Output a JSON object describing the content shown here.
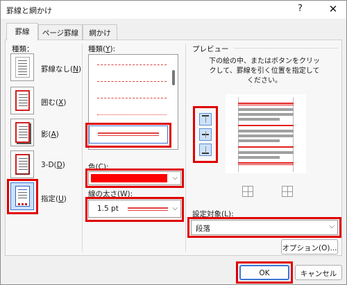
{
  "dialog": {
    "title": "罫線と網かけ",
    "help_label": "?",
    "close_label": "✕"
  },
  "tabs": [
    {
      "label": "罫線",
      "active": true
    },
    {
      "label": "ページ罫線",
      "active": false
    },
    {
      "label": "網かけ",
      "active": false
    }
  ],
  "setting": {
    "heading": "種類：",
    "options": [
      {
        "label": "罫線なし(",
        "key": "N",
        "suffix": ")",
        "selected": false
      },
      {
        "label": "囲む(",
        "key": "X",
        "suffix": ")",
        "selected": false
      },
      {
        "label": "影(",
        "key": "A",
        "suffix": ")",
        "selected": false
      },
      {
        "label": "3-D(",
        "key": "D",
        "suffix": ")",
        "selected": false
      },
      {
        "label": "指定(",
        "key": "U",
        "suffix": ")",
        "selected": true
      }
    ]
  },
  "style": {
    "heading_prefix": "種類(",
    "heading_key": "Y",
    "heading_suffix": "):",
    "selected_style": "solid-double-red"
  },
  "color": {
    "label_prefix": "色(",
    "label_key": "C",
    "label_suffix": "):",
    "value_hex": "#ff0000"
  },
  "width": {
    "label_prefix": "線の太さ(",
    "label_key": "W",
    "label_suffix": "):",
    "value": "1.5 pt"
  },
  "preview": {
    "heading": "プレビュー",
    "instruction": "下の絵の中、またはボタンをクリックして、罫線を引く位置を指定してください。"
  },
  "apply_to": {
    "label_prefix": "設定対象(",
    "label_key": "L",
    "label_suffix": "):",
    "value": "段落"
  },
  "buttons": {
    "options_label": "オプション(O)...",
    "ok_label": "OK",
    "cancel_label": "キャンセル"
  },
  "colors": {
    "highlight": "#e00000",
    "accent_blue": "#3b77d6"
  }
}
